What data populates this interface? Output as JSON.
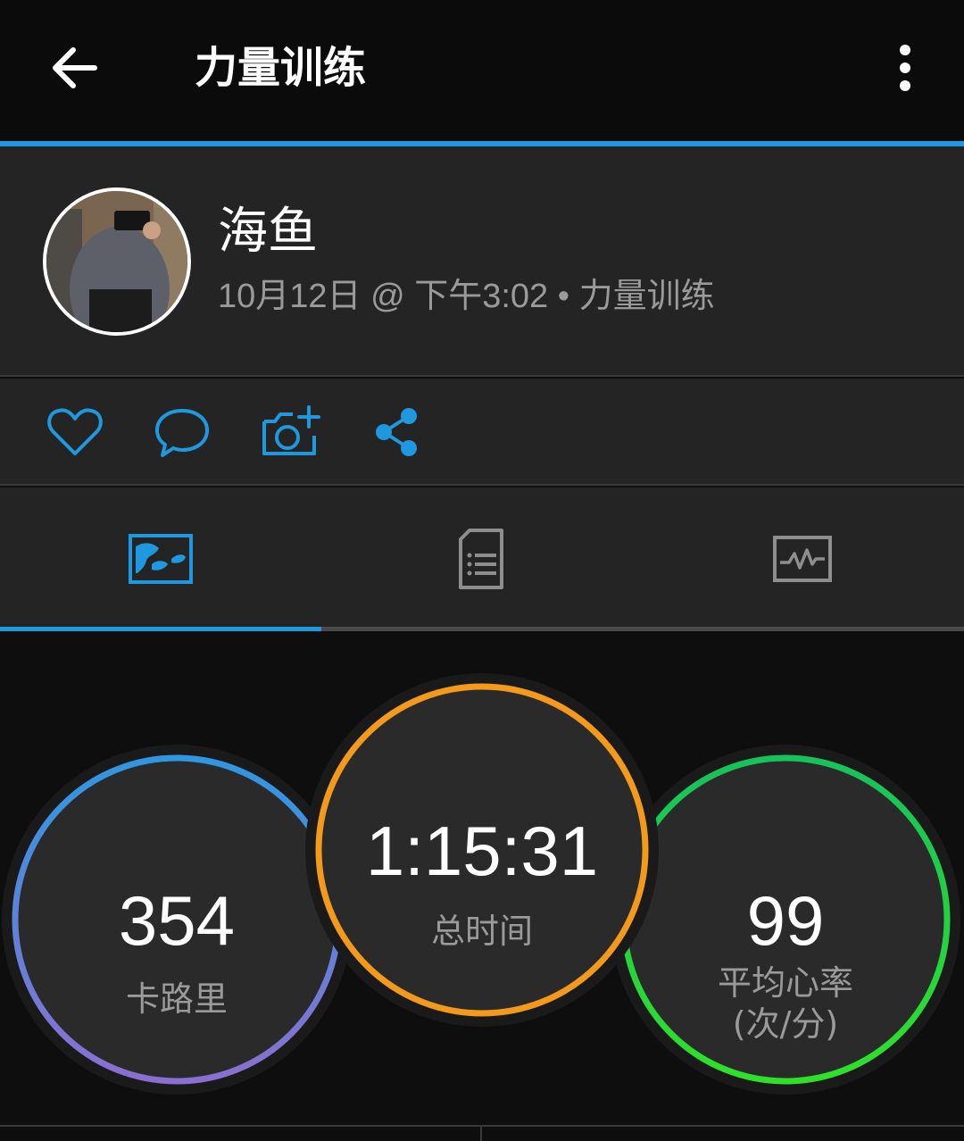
{
  "header": {
    "title": "力量训练",
    "back_icon": "arrow-left-icon",
    "more_icon": "more-vertical-icon"
  },
  "profile": {
    "name": "海鱼",
    "meta": "10月12日 @ 下午3:02 • 力量训练",
    "avatar_icon": "user-avatar-photo"
  },
  "actions": [
    {
      "icon": "heart-icon"
    },
    {
      "icon": "comment-icon"
    },
    {
      "icon": "add-photo-icon"
    },
    {
      "icon": "share-icon"
    }
  ],
  "tabs": [
    {
      "icon": "map-overview-icon",
      "active": true
    },
    {
      "icon": "stats-list-icon",
      "active": false
    },
    {
      "icon": "chart-icon",
      "active": false
    }
  ],
  "stats": {
    "calories": {
      "value": "354",
      "label": "卡路里"
    },
    "time": {
      "value": "1:15:31",
      "label": "总时间"
    },
    "heart_rate": {
      "value": "99",
      "label_line1": "平均心率",
      "label_line2": "(次/分)"
    }
  },
  "colors": {
    "accent": "#1e98de",
    "calories_ring_start": "#2f97e0",
    "calories_ring_end": "#8a6fd0",
    "time_ring": "#f39a1c",
    "hr_ring_start": "#17c25a",
    "hr_ring_end": "#2fe02a"
  }
}
